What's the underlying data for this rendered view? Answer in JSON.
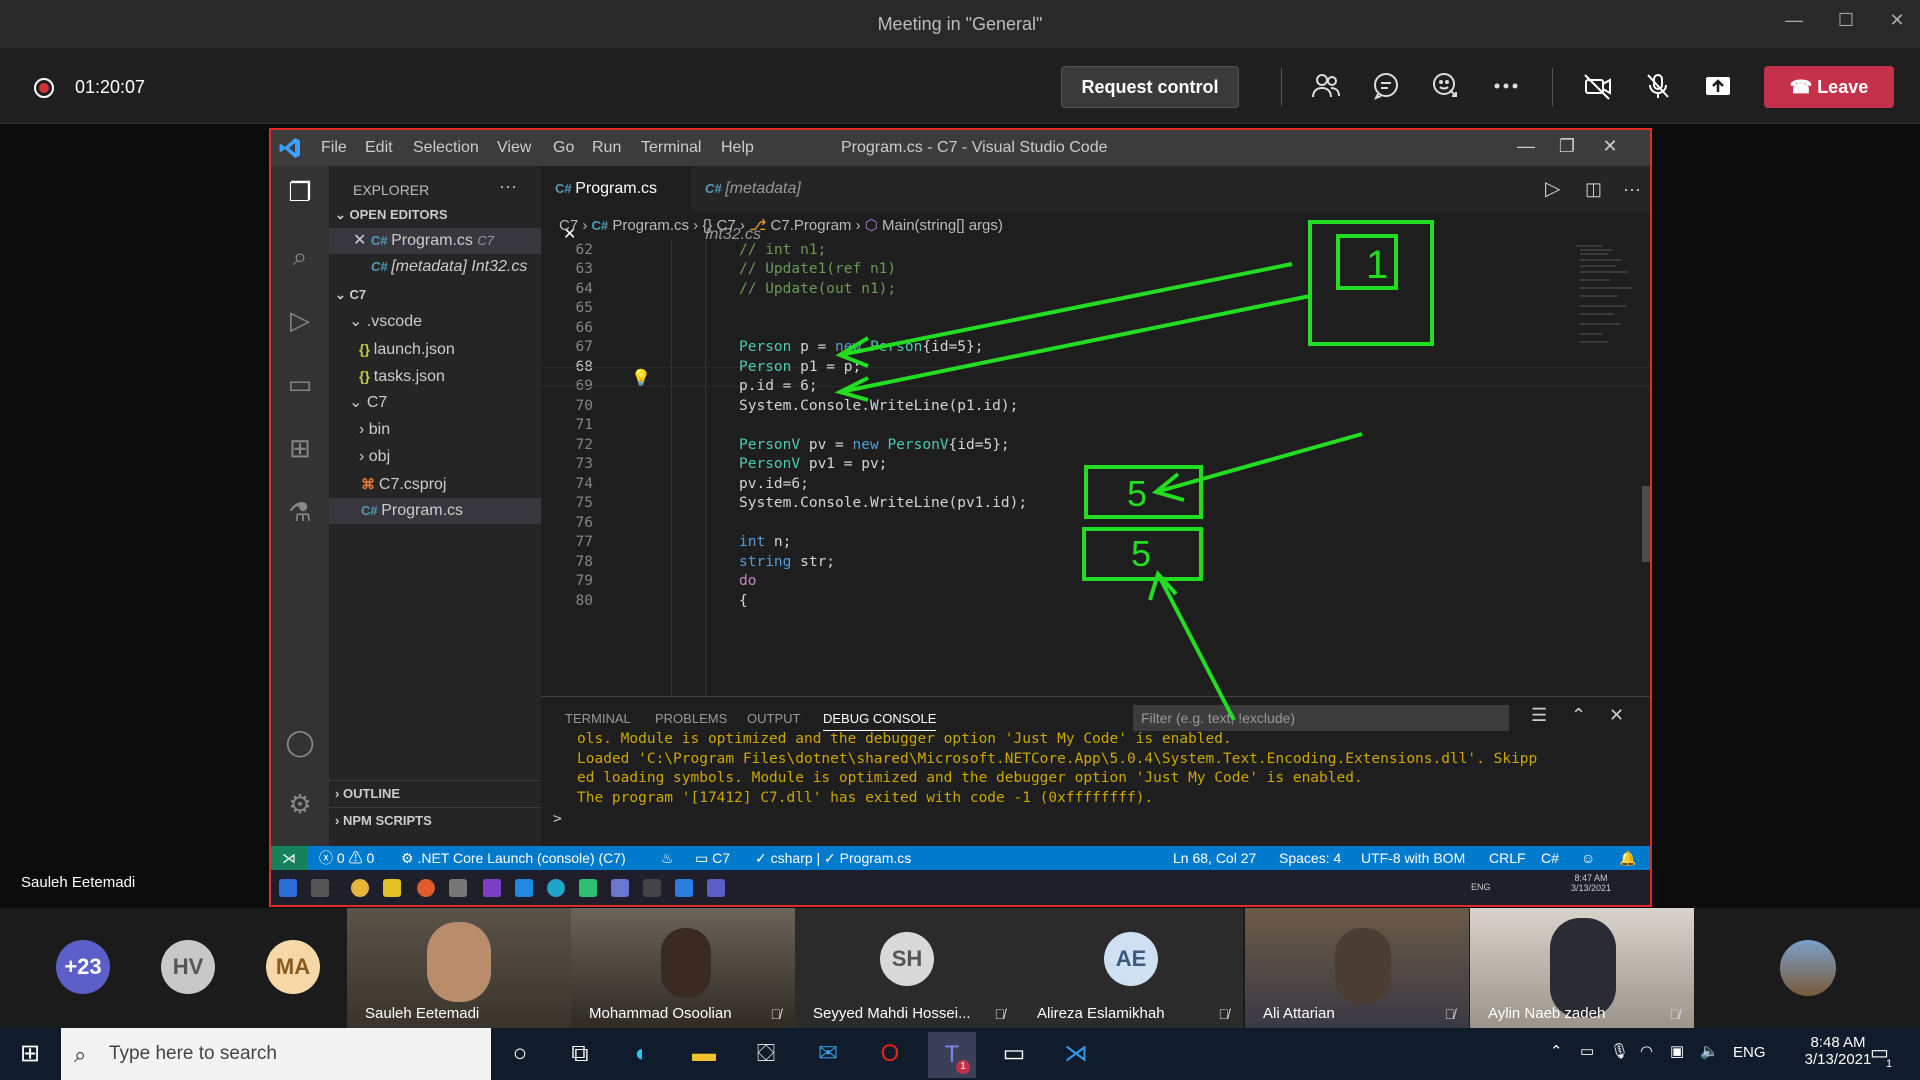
{
  "teams": {
    "window_title": "Meeting in \"General\"",
    "window_controls": {
      "minimize": "—",
      "maximize": "☐",
      "close": "✕"
    },
    "recording_time": "01:20:07",
    "request_control_label": "Request control",
    "leave_label": "Leave",
    "presenter_name": "Sauleh Eetemadi"
  },
  "vscode": {
    "menu": [
      "File",
      "Edit",
      "Selection",
      "View",
      "Go",
      "Run",
      "Terminal",
      "Help"
    ],
    "title": "Program.cs - C7 - Visual Studio Code",
    "sidebar": {
      "header": "EXPLORER",
      "more": "···",
      "open_editors_label": "OPEN EDITORS",
      "open_editors": [
        {
          "name": "Program.cs",
          "folder": "C7"
        },
        {
          "name": "[metadata] Int32.cs"
        }
      ],
      "project_label": "C7",
      "tree": {
        "vscode_folder": ".vscode",
        "launch": "launch.json",
        "tasks": "tasks.json",
        "c7_folder": "C7",
        "bin": "bin",
        "obj": "obj",
        "csproj": "C7.csproj",
        "program": "Program.cs"
      },
      "outline_label": "OUTLINE",
      "npm_label": "NPM SCRIPTS"
    },
    "tabs": [
      {
        "label": "Program.cs"
      },
      {
        "label": "[metadata] Int32.cs"
      }
    ],
    "breadcrumb": [
      "C7",
      "Program.cs",
      "{} C7",
      "C7.Program",
      "Main(string[] args)"
    ],
    "line_numbers": [
      "62",
      "63",
      "64",
      "65",
      "66",
      "67",
      "68",
      "69",
      "70",
      "71",
      "72",
      "73",
      "74",
      "75",
      "76",
      "77",
      "78",
      "79",
      "80"
    ],
    "current_line": "68",
    "code": {
      "l62": "// int n1;",
      "l63": "// Update1(ref n1)",
      "l64": "// Update(out n1);",
      "l67a": "Person",
      "l67b": " p = ",
      "l67c": "new",
      "l67d": "Person",
      "l67e": "{id=5};",
      "l68a": "Person",
      "l68b": " p1 = p;",
      "l69": "p.id = 6;",
      "l70": "System.Console.WriteLine(p1.id);",
      "l72a": "PersonV",
      "l72b": " pv = ",
      "l72c": "new",
      "l72d": "PersonV",
      "l72e": "{id=5};",
      "l73a": "PersonV",
      "l73b": " pv1 = pv;",
      "l74": "pv.id=6;",
      "l75": "System.Console.WriteLine(pv1.id);",
      "l77a": "int",
      "l77b": " n;",
      "l78a": "string",
      "l78b": " str;",
      "l79": "do",
      "l80": "{"
    },
    "panel": {
      "tabs": [
        "TERMINAL",
        "PROBLEMS",
        "OUTPUT",
        "DEBUG CONSOLE"
      ],
      "filter_placeholder": "Filter (e.g. text, !exclude)",
      "console_lines": [
        "ols. Module is optimized and the debugger option 'Just My Code' is enabled.",
        "Loaded 'C:\\Program Files\\dotnet\\shared\\Microsoft.NETCore.App\\5.0.4\\System.Text.Encoding.Extensions.dll'. Skipp",
        "ed loading symbols. Module is optimized and the debugger option 'Just My Code' is enabled.",
        "The program '[17412] C7.dll' has exited with code -1 (0xffffffff)."
      ],
      "prompt": ">"
    },
    "status": {
      "errors": "0",
      "warnings": "0",
      "launch": ".NET Core Launch (console) (C7)",
      "project": "C7",
      "omnisharp": "csharp | ✓ Program.cs",
      "position": "Ln 68, Col 27",
      "spaces": "Spaces: 4",
      "encoding": "UTF-8 with BOM",
      "eol": "CRLF",
      "language": "C#"
    },
    "inner_clock": {
      "time": "8:47 AM",
      "date": "3/13/2021",
      "lang": "ENG"
    }
  },
  "annotations": {
    "box1": "1",
    "box2": "5",
    "box3": "5",
    "color": "#22dd22"
  },
  "participants": {
    "overflow": "+23",
    "avatars": [
      {
        "initials": "HV",
        "color": "#c8c8c8"
      },
      {
        "initials": "MA",
        "color": "#f6d7a7"
      }
    ],
    "tiles": [
      {
        "name": "Sauleh Eetemadi"
      },
      {
        "name": "Mohammad Osoolian"
      },
      {
        "name": "Seyyed Mahdi Hossei...",
        "initials": "SH"
      },
      {
        "name": "Alireza Eslamikhah",
        "initials": "AE"
      },
      {
        "name": "Ali Attarian"
      },
      {
        "name": "Aylin Naeb zadeh"
      }
    ]
  },
  "taskbar": {
    "search_placeholder": "Type here to search",
    "lang": "ENG",
    "time": "8:48 AM",
    "date": "3/13/2021",
    "notifications": "1",
    "teams_badge": "1"
  }
}
